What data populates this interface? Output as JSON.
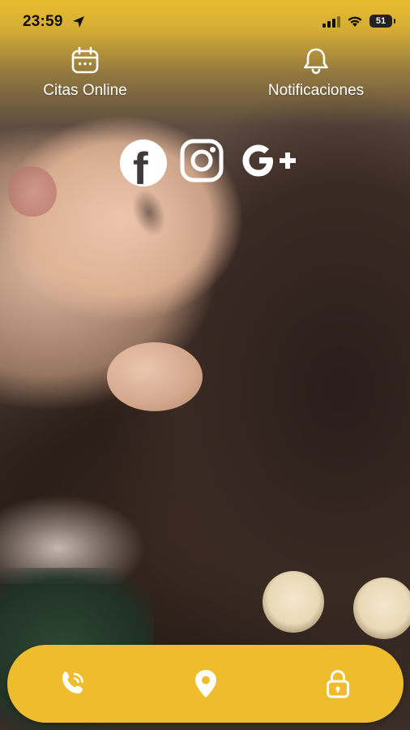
{
  "status_bar": {
    "time": "23:59",
    "battery": "51"
  },
  "header": {
    "appointments_label": "Citas Online",
    "notifications_label": "Notificaciones"
  },
  "social": {
    "facebook_letter": "f",
    "google_plus_label": "G+"
  },
  "colors": {
    "brand_yellow": "#eebc2c",
    "icon_white": "#ffffff"
  },
  "icons": {
    "appointments": "calendar-icon",
    "notifications": "bell-icon",
    "social": [
      "facebook-icon",
      "instagram-icon",
      "google-plus-icon"
    ],
    "bottom_nav": [
      "phone-icon",
      "location-pin-icon",
      "lock-icon"
    ]
  }
}
